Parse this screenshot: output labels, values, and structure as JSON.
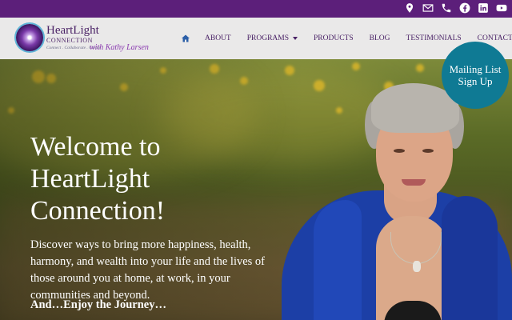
{
  "topbar": {
    "color": "#5c1f7a",
    "icons": [
      "map-marker-icon",
      "envelope-icon",
      "phone-icon",
      "facebook-icon",
      "linkedin-icon",
      "youtube-icon"
    ]
  },
  "logo": {
    "name": "HeartLight",
    "sub": "CONNECTION",
    "tagline": "Connect . Collaborate . Create",
    "signature": "with Kathy Larsen"
  },
  "nav": {
    "home_icon": "home-icon",
    "items": [
      {
        "label": "ABOUT"
      },
      {
        "label": "PROGRAMS",
        "has_dropdown": true
      },
      {
        "label": "PRODUCTS"
      },
      {
        "label": "BLOG"
      },
      {
        "label": "TESTIMONIALS"
      },
      {
        "label": "CONTACT"
      }
    ]
  },
  "mailing": {
    "line1": "Mailing List",
    "line2": "Sign Up",
    "color": "#0f7a94"
  },
  "hero": {
    "headline": [
      "Welcome to",
      "HeartLight",
      "Connection!"
    ],
    "intro": "Discover ways to bring more happiness, health, harmony, and wealth into your life and the lives of those around you at home, at work, in your communities and beyond.",
    "closing": "And…Enjoy the Journey…"
  }
}
